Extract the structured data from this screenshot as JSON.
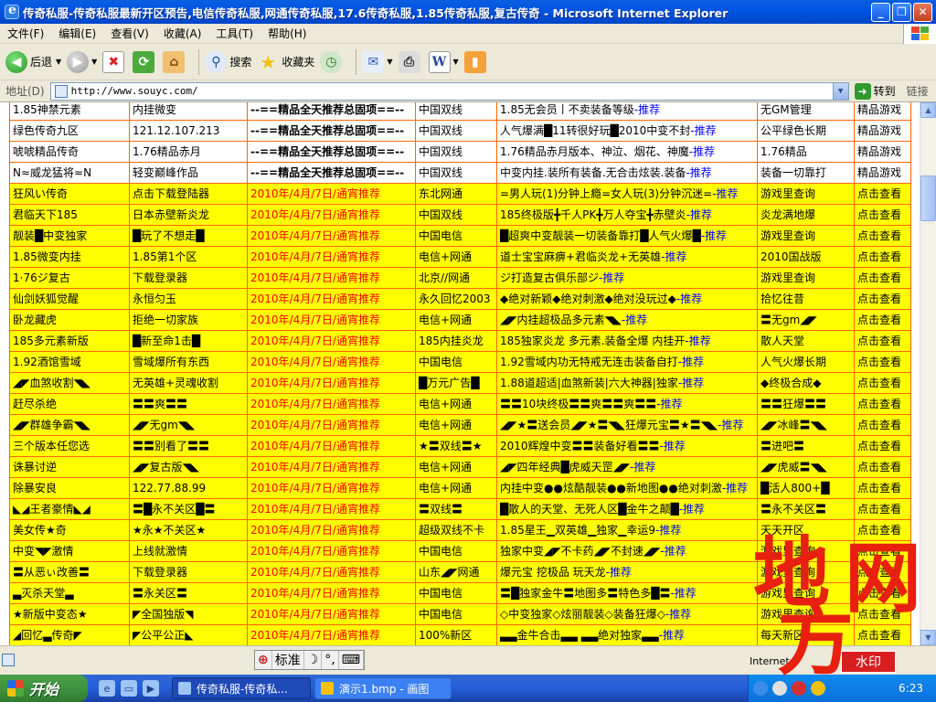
{
  "window": {
    "title": "传奇私服-传奇私服最新开区预告,电信传奇私服,网通传奇私服,17.6传奇私服,1.85传奇私服,复古传奇 - Microsoft Internet Explorer",
    "minimize": "_",
    "restore": "❐",
    "close": "✕"
  },
  "menu": [
    "文件(F)",
    "编辑(E)",
    "查看(V)",
    "收藏(A)",
    "工具(T)",
    "帮助(H)"
  ],
  "toolbar": {
    "back": "后退",
    "forward": "",
    "search": "搜索",
    "favorites": "收藏夹"
  },
  "address": {
    "label": "地址(D)",
    "url": "http://www.souyc.com/",
    "go": "转到",
    "links": "链接"
  },
  "colors": {
    "row_highlight": "#ffff00",
    "cell_border": "#ff6600",
    "recommend_text": "#0000ff",
    "date_text": "#ff0000",
    "titlebar": "#0054e3"
  },
  "rows": [
    {
      "style": "w",
      "name": "1.85神禁元素",
      "intro": "内挂微变",
      "time": "--==精品全天推荐总固项==--",
      "line": "中国双线",
      "desc": "1.85无会员丨不卖装备等级",
      "tag": "-推荐",
      "feat": "无GM管理",
      "link": "精品游戏"
    },
    {
      "style": "w",
      "name": "绿色传奇九区",
      "intro": "121.12.107.213",
      "time": "--==精品全天推荐总固项==--",
      "line": "中国双线",
      "desc": "人气爆满█11转很好玩█2010中变不封",
      "tag": "-推荐",
      "feat": "公平绿色长期",
      "link": "精品游戏"
    },
    {
      "style": "w",
      "name": "唬唬精品传奇",
      "intro": "1.76精品赤月",
      "time": "--==精品全天推荐总固项==--",
      "line": "中国双线",
      "desc": "1.76精品赤月版本、神泣、烟花、神魔",
      "tag": "-推荐",
      "feat": "1.76精品",
      "link": "精品游戏"
    },
    {
      "style": "w",
      "name": "N≈威龙猛将≈N",
      "intro": "轻变巅峰作品",
      "time": "--==精品全天推荐总固项==--",
      "line": "中国双线",
      "desc": "中变内挂.装所有装备.无合击炫装.装备",
      "tag": "-推荐",
      "feat": "装备一切靠打",
      "link": "精品游戏"
    },
    {
      "style": "y",
      "name": "狂风い传奇",
      "intro": "点击下载登陆器",
      "time": "2010年/4月/7日/通宵推荐",
      "line": "东北网通",
      "desc": "=男人玩(1)分钟上瘾=女人玩(3)分钟沉迷=",
      "tag": "-推荐",
      "feat": "游戏里查询",
      "link": "点击查看"
    },
    {
      "style": "y",
      "name": "君临天下185",
      "intro": "日本赤壁新炎龙",
      "time": "2010年/4月/7日/通宵推荐",
      "line": "中国双线",
      "desc": "185终极版╋千人PK╋万人夺宝╋赤壁炎",
      "tag": "-推荐",
      "feat": "炎龙满地爆",
      "link": "点击查看"
    },
    {
      "style": "y",
      "name": "靓装█中变独家",
      "intro": "█玩了不想走█",
      "time": "2010年/4月/7日/通宵推荐",
      "line": "中国电信",
      "desc": "█超爽中变靓装一切装备靠打█人气火爆█",
      "tag": "-推荐",
      "feat": "游戏里查询",
      "link": "点击查看"
    },
    {
      "style": "y",
      "name": "1.85微变内挂",
      "intro": "1.85第1个区",
      "time": "2010年/4月/7日/通宵推荐",
      "line": "电信+网通",
      "desc": "道士宝宝麻痹+君临炎龙+无英雄",
      "tag": "-推荐",
      "feat": "2010国战版",
      "link": "点击查看"
    },
    {
      "style": "y",
      "name": "1·76ジ复古",
      "intro": "下载登录器",
      "time": "2010年/4月/7日/通宵推荐",
      "line": "北京//网通",
      "desc": "ジ打造复古俱乐部ジ",
      "tag": "-推荐",
      "feat": "游戏里查询",
      "link": "点击查看"
    },
    {
      "style": "y",
      "name": "仙剑妖狐觉醒",
      "intro": "永恒匀玉",
      "time": "2010年/4月/7日/通宵推荐",
      "line": "永久回忆2003",
      "desc": "◆绝对新颖◆绝对刺激◆绝对没玩过◆",
      "tag": "-推荐",
      "feat": "拾忆往昔",
      "link": "点击查看"
    },
    {
      "style": "y",
      "name": "卧龙藏虎",
      "intro": "拒绝一切家族",
      "time": "2010年/4月/7日/通宵推荐",
      "line": "电信+网通",
      "desc": "◢◤内挂超极品多元素◥◣",
      "tag": "-推荐",
      "feat": "〓无gm◢◤",
      "link": "点击查看"
    },
    {
      "style": "y",
      "name": "185多元素新版",
      "intro": "█新至命1击█",
      "time": "2010年/4月/7日/通宵推荐",
      "line": "185内挂炎龙",
      "desc": "185独家炎龙 多元素.装备全爆 内挂开",
      "tag": "-推荐",
      "feat": "散人天堂",
      "link": "点击查看"
    },
    {
      "style": "y",
      "name": "1.92酒馆雪域",
      "intro": "雪域爆所有东西",
      "time": "2010年/4月/7日/通宵推荐",
      "line": "中国电信",
      "desc": "1.92雪域内功无特戒无连击装备自打",
      "tag": "-推荐",
      "feat": "人气火爆长期",
      "link": "点击查看"
    },
    {
      "style": "y",
      "name": "◢◤血煞收割◥◣",
      "intro": "无英雄+灵魂收割",
      "time": "2010年/4月/7日/通宵推荐",
      "line": "█万元广告█",
      "desc": "1.88道超适|血煞新装|六大神器|独家",
      "tag": "-推荐",
      "feat": "◆终极合成◆",
      "link": "点击查看"
    },
    {
      "style": "y",
      "name": "赶尽杀绝",
      "intro": "〓〓爽〓〓",
      "time": "2010年/4月/7日/通宵推荐",
      "line": "电信+网通",
      "desc": "〓〓10块终极〓〓爽〓〓爽〓〓",
      "tag": "-推荐",
      "feat": "〓〓狂爆〓〓",
      "link": "点击查看"
    },
    {
      "style": "y",
      "name": "◢◤群雄争霸◥◣",
      "intro": "◢◤无gm◥◣",
      "time": "2010年/4月/7日/通宵推荐",
      "line": "电信+网通",
      "desc": "◢◤★〓送会员◢◤★〓◥◣狂爆元宝〓★〓◥◣",
      "tag": "-推荐",
      "feat": "◢◤冰峰〓◥◣",
      "link": "点击查看"
    },
    {
      "style": "y",
      "name": "三个版本任您选",
      "intro": "〓〓别看了〓〓",
      "time": "2010年/4月/7日/通宵推荐",
      "line": "★〓双线〓★",
      "desc": "2010辉煌中变〓〓装备好看〓〓",
      "tag": "-推荐",
      "feat": "〓进吧〓",
      "link": "点击查看"
    },
    {
      "style": "y",
      "name": "诛暴讨逆",
      "intro": "◢◤复古版◥◣",
      "time": "2010年/4月/7日/通宵推荐",
      "line": "电信+网通",
      "desc": "◢◤四年经典█虎威天罡◢◤",
      "tag": "-推荐",
      "feat": "◢◤虎威〓◥◣",
      "link": "点击查看"
    },
    {
      "style": "y",
      "name": "除暴安良",
      "intro": "122.77.88.99",
      "time": "2010年/4月/7日/通宵推荐",
      "line": "电信+网通",
      "desc": "内挂中变●●炫酷靓装●●新地图●●绝对刺激",
      "tag": "-推荐",
      "feat": "█活人800+█",
      "link": "点击查看"
    },
    {
      "style": "y",
      "name": "◣◢王者豪情◣◢",
      "intro": "〓█永不关区█〓",
      "time": "2010年/4月/7日/通宵推荐",
      "line": "〓双线〓",
      "desc": "█散人的天堂、无死人区█金牛之颠█",
      "tag": "-推荐",
      "feat": "〓永不关区〓",
      "link": "点击查看"
    },
    {
      "style": "y",
      "name": "美女传★奇",
      "intro": "★永★不关区★",
      "time": "2010年/4月/7日/通宵推荐",
      "line": "超级双线不卡",
      "desc": "1.85星王▁双英雄▁独家▁幸运9",
      "tag": "-推荐",
      "feat": "天天开区",
      "link": "点击查看"
    },
    {
      "style": "y",
      "name": "中变◥◤激情",
      "intro": "上线就激情",
      "time": "2010年/4月/7日/通宵推荐",
      "line": "中国电信",
      "desc": "独家中变◢◤不卡药◢◤不封速◢◤",
      "tag": "-推荐",
      "feat": "游戏里查询",
      "link": "点击查看"
    },
    {
      "style": "y",
      "name": "〓从恶ぃ改善〓",
      "intro": "下载登录器",
      "time": "2010年/4月/7日/通宵推荐",
      "line": "山东◢◤网通",
      "desc": "爆元宝 挖极品 玩天龙",
      "tag": "-推荐",
      "feat": "游戏里查询",
      "link": "点击查看"
    },
    {
      "style": "y",
      "name": "▃灭杀天堂▃",
      "intro": "〓永关区〓",
      "time": "2010年/4月/7日/通宵推荐",
      "line": "中国电信",
      "desc": "〓█独家金牛〓地图多〓特色多█〓",
      "tag": "-推荐",
      "feat": "游戏里查询",
      "link": "点击查看"
    },
    {
      "style": "y",
      "name": "★新版中变态★",
      "intro": "◤全国独版◥",
      "time": "2010年/4月/7日/通宵推荐",
      "line": "中国电信",
      "desc": "◇中变独家◇炫丽靓装◇装备狂爆◇",
      "tag": "-推荐",
      "feat": "游戏里查询",
      "link": "点击查看"
    },
    {
      "style": "y",
      "name": "◢回忆▃传奇◤",
      "intro": "◤公平公正◣",
      "time": "2010年/4月/7日/通宵推荐",
      "line": "100%新区",
      "desc": "▃▃金牛合击▃▃ ▃▃绝对独家▃▃",
      "tag": "-推荐",
      "feat": "每天新区",
      "link": "点击查看"
    }
  ],
  "status": {
    "ime_mode": "标准",
    "zone": "Internet"
  },
  "taskbar": {
    "start": "开始",
    "tasks": [
      "传奇私服-传奇私...",
      "演示1.bmp - 画图"
    ],
    "clock": "6:23"
  },
  "watermark": {
    "chars": [
      "地",
      "网",
      "方"
    ],
    "chop": "水印"
  }
}
